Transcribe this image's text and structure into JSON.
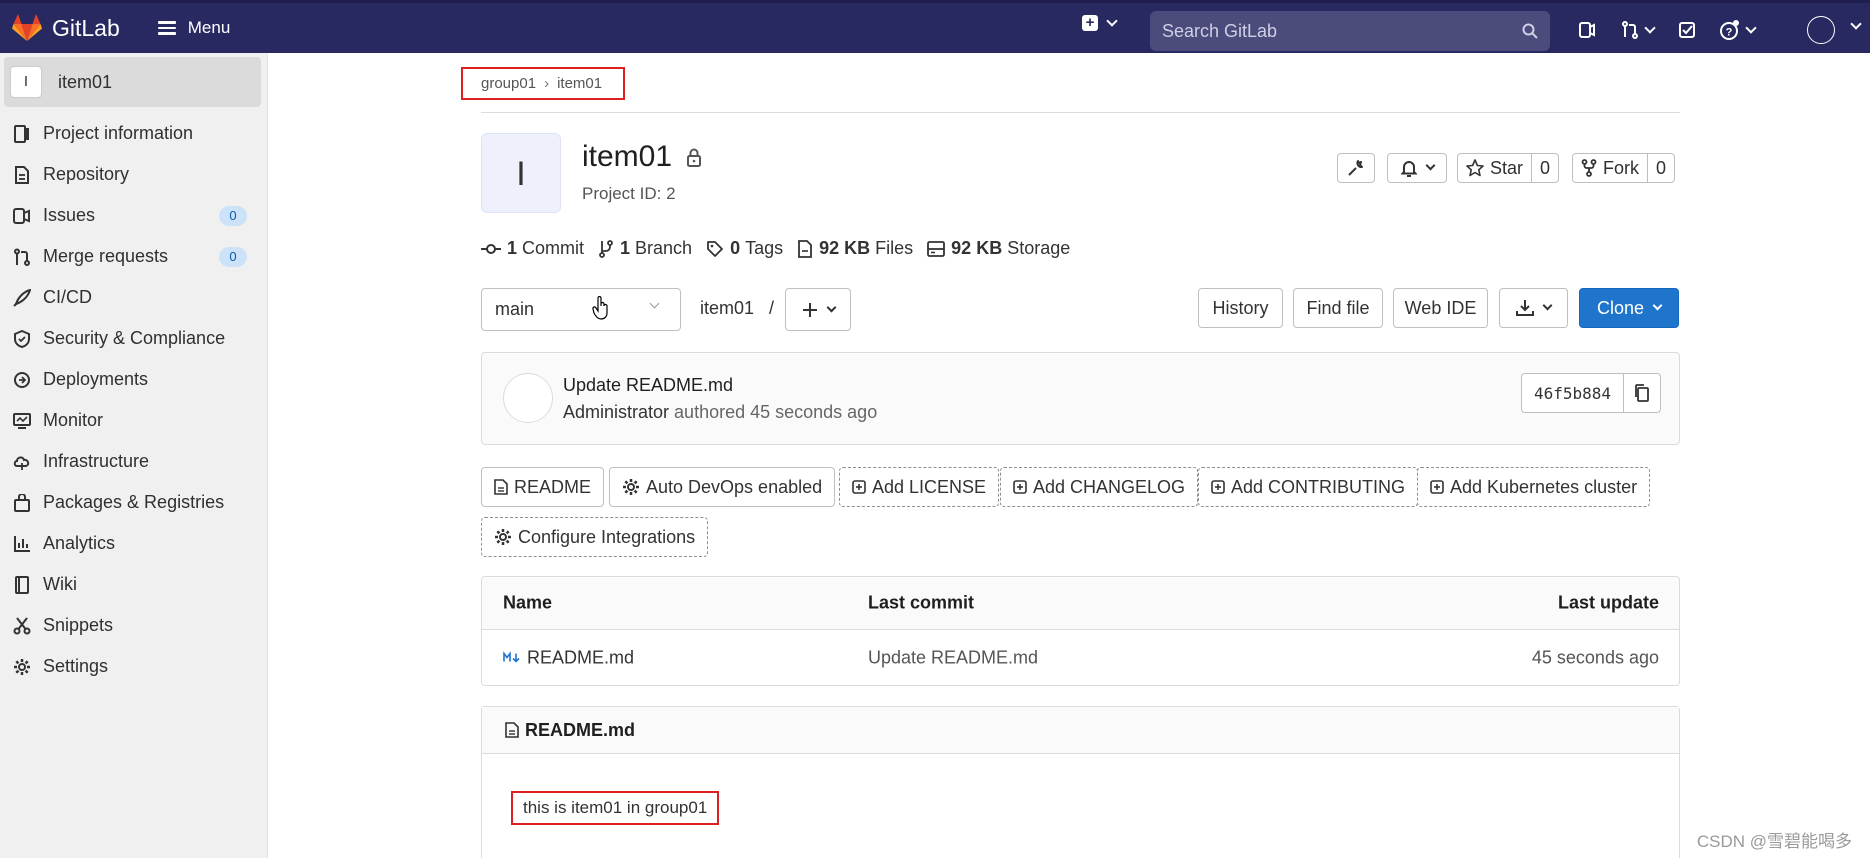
{
  "topbar": {
    "brand": "GitLab",
    "menu_label": "Menu",
    "search_placeholder": "Search GitLab"
  },
  "sidebar": {
    "project_initial": "I",
    "project_name": "item01",
    "items": [
      {
        "label": "Project information"
      },
      {
        "label": "Repository"
      },
      {
        "label": "Issues",
        "badge": "0"
      },
      {
        "label": "Merge requests",
        "badge": "0"
      },
      {
        "label": "CI/CD"
      },
      {
        "label": "Security & Compliance"
      },
      {
        "label": "Deployments"
      },
      {
        "label": "Monitor"
      },
      {
        "label": "Infrastructure"
      },
      {
        "label": "Packages & Registries"
      },
      {
        "label": "Analytics"
      },
      {
        "label": "Wiki"
      },
      {
        "label": "Snippets"
      },
      {
        "label": "Settings"
      }
    ]
  },
  "breadcrumb": {
    "group": "group01",
    "project": "item01"
  },
  "project": {
    "initial": "I",
    "title": "item01",
    "id_text": "Project ID: 2",
    "star_label": "Star",
    "star_count": "0",
    "fork_label": "Fork",
    "fork_count": "0"
  },
  "stats": {
    "commits_num": "1",
    "commits_label": "Commit",
    "branches_num": "1",
    "branches_label": "Branch",
    "tags_num": "0",
    "tags_label": "Tags",
    "files_num": "92 KB",
    "files_label": "Files",
    "storage_num": "92 KB",
    "storage_label": "Storage"
  },
  "toolbar": {
    "branch": "main",
    "path": "item01",
    "path_sep": "/",
    "history": "History",
    "find_file": "Find file",
    "web_ide": "Web IDE",
    "clone": "Clone"
  },
  "last_commit": {
    "title": "Update README.md",
    "author": "Administrator",
    "meta": "authored 45 seconds ago",
    "sha": "46f5b884"
  },
  "quick_buttons": {
    "readme": "README",
    "autodevops": "Auto DevOps enabled",
    "license": "Add LICENSE",
    "changelog": "Add CHANGELOG",
    "contributing": "Add CONTRIBUTING",
    "kubernetes": "Add Kubernetes cluster",
    "integrations": "Configure Integrations"
  },
  "file_table": {
    "headers": {
      "name": "Name",
      "last_commit": "Last commit",
      "last_update": "Last update"
    },
    "rows": [
      {
        "name": "README.md",
        "commit": "Update README.md",
        "updated": "45 seconds ago"
      }
    ]
  },
  "readme": {
    "title": "README.md",
    "content": "this is item01 in group01"
  },
  "watermark": "CSDN @雪碧能喝多",
  "colors": {
    "nav_bg": "#292961",
    "primary": "#1f75cb",
    "highlight_box": "#e02020"
  }
}
